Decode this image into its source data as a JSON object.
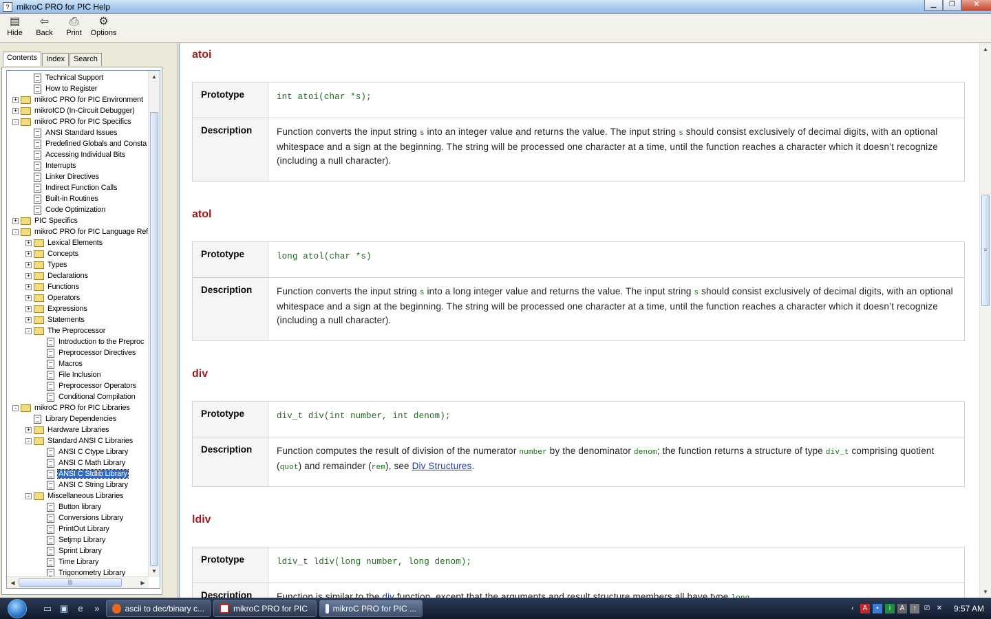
{
  "window": {
    "title": "mikroC PRO for PIC Help"
  },
  "toolbar": {
    "hide": "Hide",
    "back": "Back",
    "print": "Print",
    "options": "Options"
  },
  "tabs": [
    "Contents",
    "Index",
    "Search"
  ],
  "tree": [
    {
      "label": "Technical Support",
      "level": 2,
      "type": "page",
      "exp": ""
    },
    {
      "label": "How to Register",
      "level": 2,
      "type": "page",
      "exp": ""
    },
    {
      "label": "mikroC PRO for PIC Environment",
      "level": 1,
      "type": "folder",
      "exp": "+"
    },
    {
      "label": "mikroICD (In-Circuit Debugger)",
      "level": 1,
      "type": "folder",
      "exp": "+"
    },
    {
      "label": "mikroC PRO for PIC Specifics",
      "level": 1,
      "type": "folder",
      "exp": "-"
    },
    {
      "label": "ANSI Standard Issues",
      "level": 2,
      "type": "page",
      "exp": ""
    },
    {
      "label": "Predefined Globals and Consta",
      "level": 2,
      "type": "page",
      "exp": ""
    },
    {
      "label": "Accessing Individual Bits",
      "level": 2,
      "type": "page",
      "exp": ""
    },
    {
      "label": "Interrupts",
      "level": 2,
      "type": "page",
      "exp": ""
    },
    {
      "label": "Linker Directives",
      "level": 2,
      "type": "page",
      "exp": ""
    },
    {
      "label": "Indirect Function Calls",
      "level": 2,
      "type": "page",
      "exp": ""
    },
    {
      "label": "Built-in Routines",
      "level": 2,
      "type": "page",
      "exp": ""
    },
    {
      "label": "Code Optimization",
      "level": 2,
      "type": "page",
      "exp": ""
    },
    {
      "label": "PIC Specifics",
      "level": 1,
      "type": "folder",
      "exp": "+"
    },
    {
      "label": "mikroC PRO for PIC Language Ref",
      "level": 1,
      "type": "folder",
      "exp": "-"
    },
    {
      "label": "Lexical Elements",
      "level": 2,
      "type": "folder",
      "exp": "+"
    },
    {
      "label": "Concepts",
      "level": 2,
      "type": "folder",
      "exp": "+"
    },
    {
      "label": "Types",
      "level": 2,
      "type": "folder",
      "exp": "+"
    },
    {
      "label": "Declarations",
      "level": 2,
      "type": "folder",
      "exp": "+"
    },
    {
      "label": "Functions",
      "level": 2,
      "type": "folder",
      "exp": "+"
    },
    {
      "label": "Operators",
      "level": 2,
      "type": "folder",
      "exp": "+"
    },
    {
      "label": "Expressions",
      "level": 2,
      "type": "folder",
      "exp": "+"
    },
    {
      "label": "Statements",
      "level": 2,
      "type": "folder",
      "exp": "+"
    },
    {
      "label": "The Preprocessor",
      "level": 2,
      "type": "folder",
      "exp": "-"
    },
    {
      "label": "Introduction to the Preproc",
      "level": 3,
      "type": "page",
      "exp": ""
    },
    {
      "label": "Preprocessor Directives",
      "level": 3,
      "type": "page",
      "exp": ""
    },
    {
      "label": "Macros",
      "level": 3,
      "type": "page",
      "exp": ""
    },
    {
      "label": "File Inclusion",
      "level": 3,
      "type": "page",
      "exp": ""
    },
    {
      "label": "Preprocessor Operators",
      "level": 3,
      "type": "page",
      "exp": ""
    },
    {
      "label": "Conditional Compilation",
      "level": 3,
      "type": "page",
      "exp": ""
    },
    {
      "label": "mikroC PRO for PIC Libraries",
      "level": 1,
      "type": "folder",
      "exp": "-"
    },
    {
      "label": "Library Dependencies",
      "level": 2,
      "type": "page",
      "exp": ""
    },
    {
      "label": "Hardware Libraries",
      "level": 2,
      "type": "folder",
      "exp": "+"
    },
    {
      "label": "Standard ANSI C Libraries",
      "level": 2,
      "type": "folder",
      "exp": "-"
    },
    {
      "label": "ANSI C Ctype Library",
      "level": 3,
      "type": "page",
      "exp": ""
    },
    {
      "label": "ANSI C Math Library",
      "level": 3,
      "type": "page",
      "exp": ""
    },
    {
      "label": "ANSI C Stdlib Library",
      "level": 3,
      "type": "page",
      "exp": "",
      "selected": true
    },
    {
      "label": "ANSI C String Library",
      "level": 3,
      "type": "page",
      "exp": ""
    },
    {
      "label": "Miscellaneous Libraries",
      "level": 2,
      "type": "folder",
      "exp": "-"
    },
    {
      "label": "Button library",
      "level": 3,
      "type": "page",
      "exp": ""
    },
    {
      "label": "Conversions Library",
      "level": 3,
      "type": "page",
      "exp": ""
    },
    {
      "label": "PrintOut Library",
      "level": 3,
      "type": "page",
      "exp": ""
    },
    {
      "label": "Setjmp Library",
      "level": 3,
      "type": "page",
      "exp": ""
    },
    {
      "label": "Sprint Library",
      "level": 3,
      "type": "page",
      "exp": ""
    },
    {
      "label": "Time Library",
      "level": 3,
      "type": "page",
      "exp": ""
    },
    {
      "label": "Trigonometry Library",
      "level": 3,
      "type": "page",
      "exp": ""
    }
  ],
  "content": {
    "labels": {
      "prototype": "Prototype",
      "description": "Description"
    },
    "atoi": {
      "title": "atoi",
      "proto": "int atoi(char *s);",
      "desc_1": "Function converts the input string ",
      "desc_s1": "s",
      "desc_2": " into an integer value and returns the value. The input string ",
      "desc_s2": "s",
      "desc_3": " should consist exclusively of decimal digits, with an optional whitespace and a sign at the beginning. The string will be processed one character at a time, until the function reaches a character which it doesn’t recognize (including a null character)."
    },
    "atol": {
      "title": "atol",
      "proto": "long atol(char *s)",
      "desc_1": "Function converts the input string ",
      "desc_s1": "s",
      "desc_2": " into a long integer value and returns the value. The input string ",
      "desc_s2": "s",
      "desc_3": " should consist exclusively of decimal digits, with an optional whitespace and a sign at the beginning. The string will be processed one character at a time, until the function reaches a character which it doesn’t recognize (including a null character)."
    },
    "div": {
      "title": "div",
      "proto": "div_t div(int number, int denom);",
      "desc_1": "Function computes the result of division of the numerator ",
      "desc_number": "number",
      "desc_2": " by the denominator ",
      "desc_denom": "denom",
      "desc_3": "; the function returns a structure of type ",
      "desc_divt": "div_t",
      "desc_4": " comprising quotient (",
      "desc_quot": "quot",
      "desc_5": ") and remainder (",
      "desc_rem": "rem",
      "desc_6": "), see ",
      "desc_link": "Div Structures",
      "desc_7": "."
    },
    "ldiv": {
      "title": "ldiv",
      "proto": "ldiv_t ldiv(long number, long denom);",
      "desc_1": "Function is similar to the ",
      "desc_div": "div",
      "desc_2": " function, except that the arguments and result structure members all have type ",
      "desc_long": "long",
      "desc_3": "."
    }
  },
  "taskbar": {
    "tasks": [
      "ascii to dec/binary c...",
      "mikroC PRO for PIC",
      "mikroC PRO for PIC ..."
    ],
    "clock": "9:57 AM"
  },
  "colors": {
    "accent": "#9e1b1b",
    "code": "#1b6a1b",
    "link": "#1a3fb0",
    "selection": "#316ac5"
  }
}
